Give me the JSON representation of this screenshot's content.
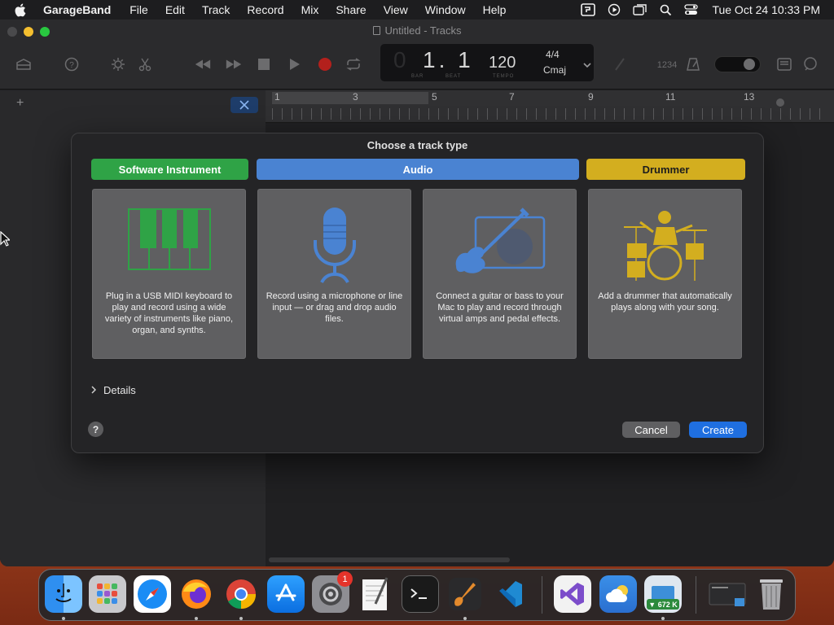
{
  "menubar": {
    "app_name": "GarageBand",
    "items": [
      "File",
      "Edit",
      "Track",
      "Record",
      "Mix",
      "Share",
      "View",
      "Window",
      "Help"
    ],
    "clock": "Tue Oct 24  10:33 PM",
    "status_icons": [
      "screen-mirror-icon",
      "play-circle-icon",
      "windows-icon",
      "search-icon",
      "control-center-icon"
    ]
  },
  "window": {
    "title": "Untitled - Tracks"
  },
  "lcd": {
    "bar_beat": "1. 1",
    "bar_label": "BAR",
    "beat_label": "BEAT",
    "tempo": "120",
    "tempo_label": "TEMPO",
    "time_signature": "4/4",
    "key": "Cmaj"
  },
  "ruler": {
    "bar_numbers": [
      "1",
      "3",
      "5",
      "7",
      "9",
      "11",
      "13"
    ]
  },
  "dialog": {
    "heading": "Choose a track type",
    "types": [
      {
        "label": "Software Instrument",
        "color": "#2fa346",
        "description": "Plug in a USB MIDI keyboard to play and record using a wide variety of instruments like piano, organ, and synths."
      },
      {
        "label": "Audio",
        "color": "#4a83d2",
        "description": "Record using a microphone or line input — or drag and drop audio files."
      },
      {
        "label": "",
        "color": "#4a83d2",
        "description": "Connect a guitar or bass to your Mac to play and record through virtual amps and pedal effects."
      },
      {
        "label": "Drummer",
        "color": "#d3ae1f",
        "description": "Add a drummer that automatically plays along with your song."
      }
    ],
    "details_label": "Details",
    "help_label": "?",
    "cancel_label": "Cancel",
    "create_label": "Create"
  },
  "dock": {
    "apps": [
      "Finder",
      "Launchpad",
      "Safari",
      "Firefox",
      "Chrome",
      "App Store",
      "System Settings",
      "TextEdit",
      "Terminal",
      "GarageBand",
      "Visual Studio Code",
      "Visual Studio",
      "Weather",
      "Network Monitor",
      "Screenshot",
      "Trash"
    ],
    "settings_badge": "1",
    "network_label": "▼ 672 K"
  }
}
